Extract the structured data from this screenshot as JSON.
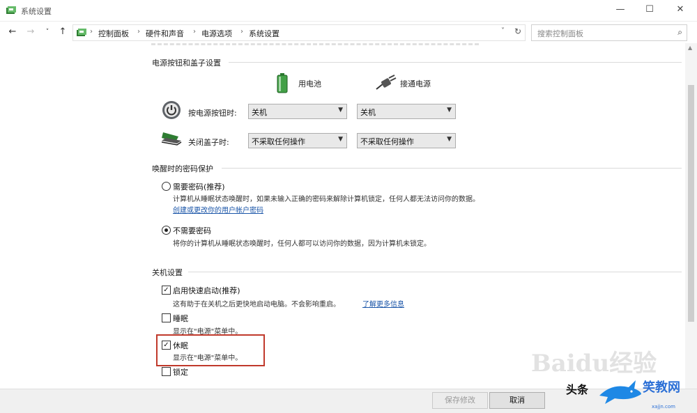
{
  "window": {
    "title": "系统设置",
    "minimize": "—",
    "maximize": "☐",
    "close": "✕"
  },
  "nav": {
    "back": "←",
    "forward": "→",
    "recent": "˅",
    "up": "↑",
    "breadcrumbs": [
      "控制面板",
      "硬件和声音",
      "电源选项",
      "系统设置"
    ],
    "separator": "›",
    "dropdown": "˅",
    "refresh": "↻",
    "search_placeholder": "搜索控制面板",
    "search_icon": "⌕"
  },
  "buttons_section": {
    "heading": "电源按钮和盖子设置",
    "col_battery": "用电池",
    "col_plugged": "接通电源",
    "rows": [
      {
        "label": "按电源按钮时:",
        "icon": "power-button-icon",
        "battery": "关机",
        "plugged": "关机"
      },
      {
        "label": "关闭盖子时:",
        "icon": "laptop-lid-icon",
        "battery": "不采取任何操作",
        "plugged": "不采取任何操作"
      }
    ]
  },
  "password_section": {
    "heading": "唤醒时的密码保护",
    "options": [
      {
        "label": "需要密码(推荐)",
        "selected": false,
        "desc": "计算机从睡眠状态唤醒时，如果未输入正确的密码来解除计算机锁定，任何人都无法访问你的数据。",
        "link": "创建或更改你的用户帐户密码"
      },
      {
        "label": "不需要密码",
        "selected": true,
        "desc": "将你的计算机从睡眠状态唤醒时，任何人都可以访问你的数据，因为计算机未锁定。"
      }
    ]
  },
  "shutdown_section": {
    "heading": "关机设置",
    "options": [
      {
        "label": "启用快速启动(推荐)",
        "checked": true,
        "desc": "这有助于在关机之后更快地启动电脑。不会影响重启。",
        "link": "了解更多信息"
      },
      {
        "label": "睡眠",
        "checked": false,
        "desc": "显示在\"电源\"菜单中。"
      },
      {
        "label": "休眠",
        "checked": true,
        "desc": "显示在\"电源\"菜单中。"
      },
      {
        "label": "锁定",
        "checked": false
      }
    ]
  },
  "footer": {
    "save": "保存修改",
    "cancel": "取消"
  },
  "watermarks": {
    "baidu": "Baidu经验",
    "toutiao": "头条",
    "site": "笑教网",
    "url": "xajjn.com"
  },
  "colors": {
    "highlight": "#c0392b",
    "link": "#1a55a8"
  }
}
